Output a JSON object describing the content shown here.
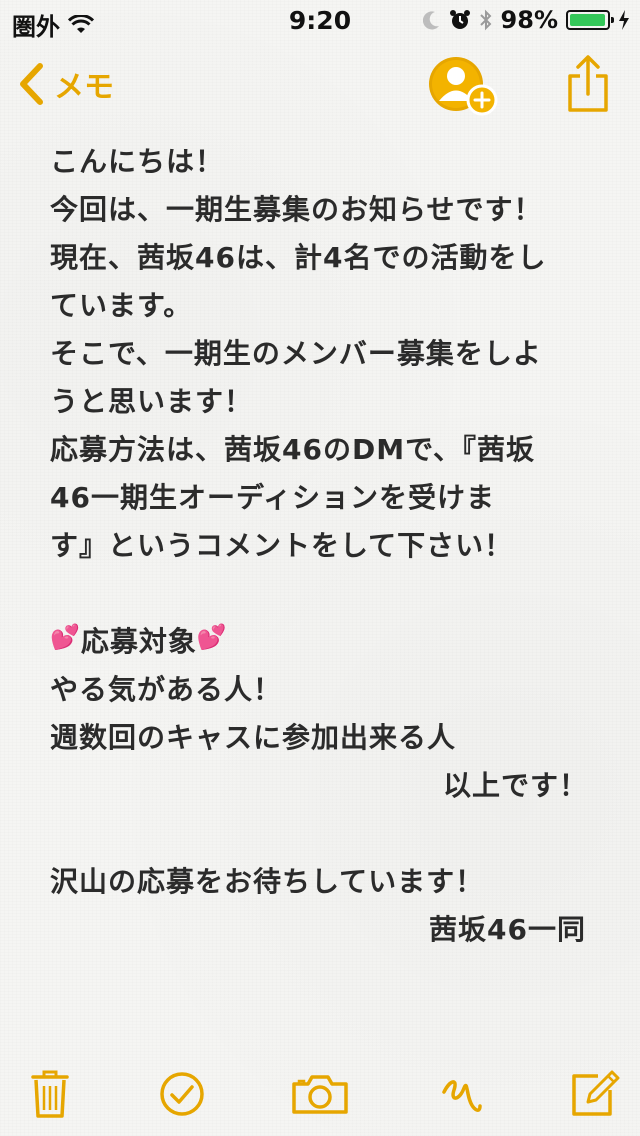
{
  "status_bar": {
    "carrier": "圏外",
    "time": "9:20",
    "battery_percent": "98%",
    "battery_level": 0.98
  },
  "nav": {
    "back_label": "メモ"
  },
  "note": {
    "lines": [
      "こんにちは！",
      "今回は、一期生募集のお知らせです！",
      "現在、茜坂46は、計4名での活動をし",
      "ています。",
      "そこで、一期生のメンバー募集をしよ",
      "うと思います！",
      "応募方法は、茜坂46のDMで、『茜坂",
      "46一期生オーディションを受けま",
      "す』というコメントをして下さい！"
    ],
    "section_title_prefix": "💕",
    "section_title": "応募対象",
    "section_title_suffix": "💕",
    "target_lines": [
      "やる気がある人！",
      "週数回のキャスに参加出来る人"
    ],
    "closing_right": "以上です！",
    "final_line": "沢山の応募をお待ちしています！",
    "signature": "茜坂46一同"
  },
  "colors": {
    "accent": "#e6a600",
    "battery": "#34c759",
    "heart": "#ff4fa3"
  },
  "icons": {
    "toolbar": [
      "trash-icon",
      "checkmark-circle-icon",
      "camera-icon",
      "sketch-icon",
      "compose-icon"
    ]
  }
}
